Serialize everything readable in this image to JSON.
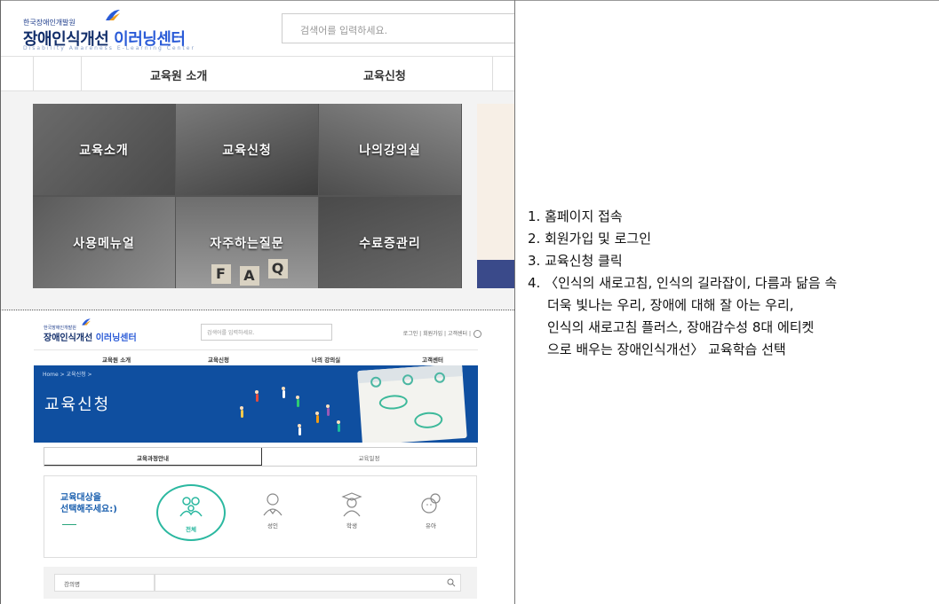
{
  "screen1": {
    "logo_small": "한국장애인개발원",
    "logo_main_a": "장애인식개선",
    "logo_main_b": "이러닝센터",
    "logo_sub": "Disability Awareness E-Learning Center",
    "search_placeholder": "검색어를 입력하세요.",
    "nav": [
      "교육원 소개",
      "교육신청"
    ],
    "tiles": [
      "교육소개",
      "교육신청",
      "나의강의실",
      "사용메뉴얼",
      "자주하는질문",
      "수료증관리"
    ],
    "faq_letters": [
      "F",
      "A",
      "Q"
    ]
  },
  "screen2": {
    "logo_small": "한국장애인개발원",
    "logo_main_a": "장애인식개선",
    "logo_main_b": "이러닝센터",
    "search_placeholder": "검색어를 입력하세요.",
    "util_links": "로그인 | 회원가입 | 고객센터 |",
    "nav": [
      "교육원 소개",
      "교육신청",
      "나의 강의실",
      "고객센터"
    ],
    "breadcrumb": "Home  >  교육신청  >",
    "banner_title": "교육신청",
    "tabs": [
      "교육과정안내",
      "교육일정"
    ],
    "target_label_line1": "교육대상을",
    "target_label_line2": "선택해주세요:)",
    "targets": [
      "전체",
      "성인",
      "학생",
      "유아"
    ],
    "select_label": "강의명",
    "chevron": "⌄"
  },
  "steps": [
    "1. 홈페이지 접속",
    "2. 회원가입 및 로그인",
    "3. 교육신청 클릭",
    "4. 〈인식의 새로고침, 인식의 길라잡이, 다름과 닮음 속"
  ],
  "step4_cont": [
    "더욱 빛나는 우리, 장애에 대해 잘 아는 우리,",
    "인식의 새로고침 플러스, 장애감수성 8대 에티켓",
    "으로 배우는 장애인식개선〉 교육학습 선택"
  ],
  "colors": {
    "banner_blue": "#0f4fa0",
    "brand_navy": "#132f6b",
    "accent_teal": "#2bb8a0"
  }
}
